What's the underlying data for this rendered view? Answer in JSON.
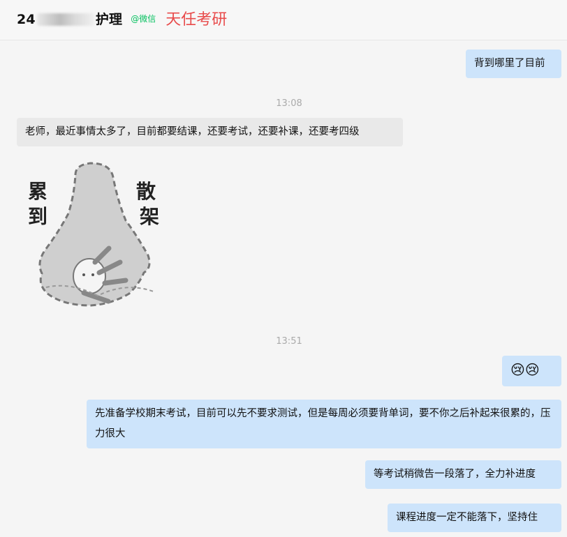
{
  "header": {
    "name_prefix": "24",
    "name_suffix": "护理",
    "tag": "@微信",
    "watermark": "天任考研"
  },
  "messages": [
    {
      "side": "right",
      "text": "背到哪里了目前"
    },
    {
      "type": "time",
      "text": "13:08"
    },
    {
      "side": "left",
      "text": "老师，最近事情太多了，目前都要结课，还要考试，还要补课，还要考四级"
    },
    {
      "side": "left",
      "type": "sticker",
      "text_left": "累到",
      "text_right": "散架"
    },
    {
      "type": "time",
      "text": "13:51"
    },
    {
      "side": "right",
      "text": "😢😢"
    },
    {
      "side": "right",
      "text": "先准备学校期末考试，目前可以先不要求测试，但是每周必须要背单词，要不你之后补起来很累的，压力很大"
    },
    {
      "side": "right",
      "text": "等考试稍微告一段落了，全力补进度"
    },
    {
      "side": "right",
      "text": "课程进度一定不能落下，坚持住"
    }
  ],
  "colors": {
    "right_bubble": "#cde4fb",
    "left_bubble": "#e9e9e9",
    "watermark": "#e84b4b",
    "wechat_tag": "#07c160"
  }
}
